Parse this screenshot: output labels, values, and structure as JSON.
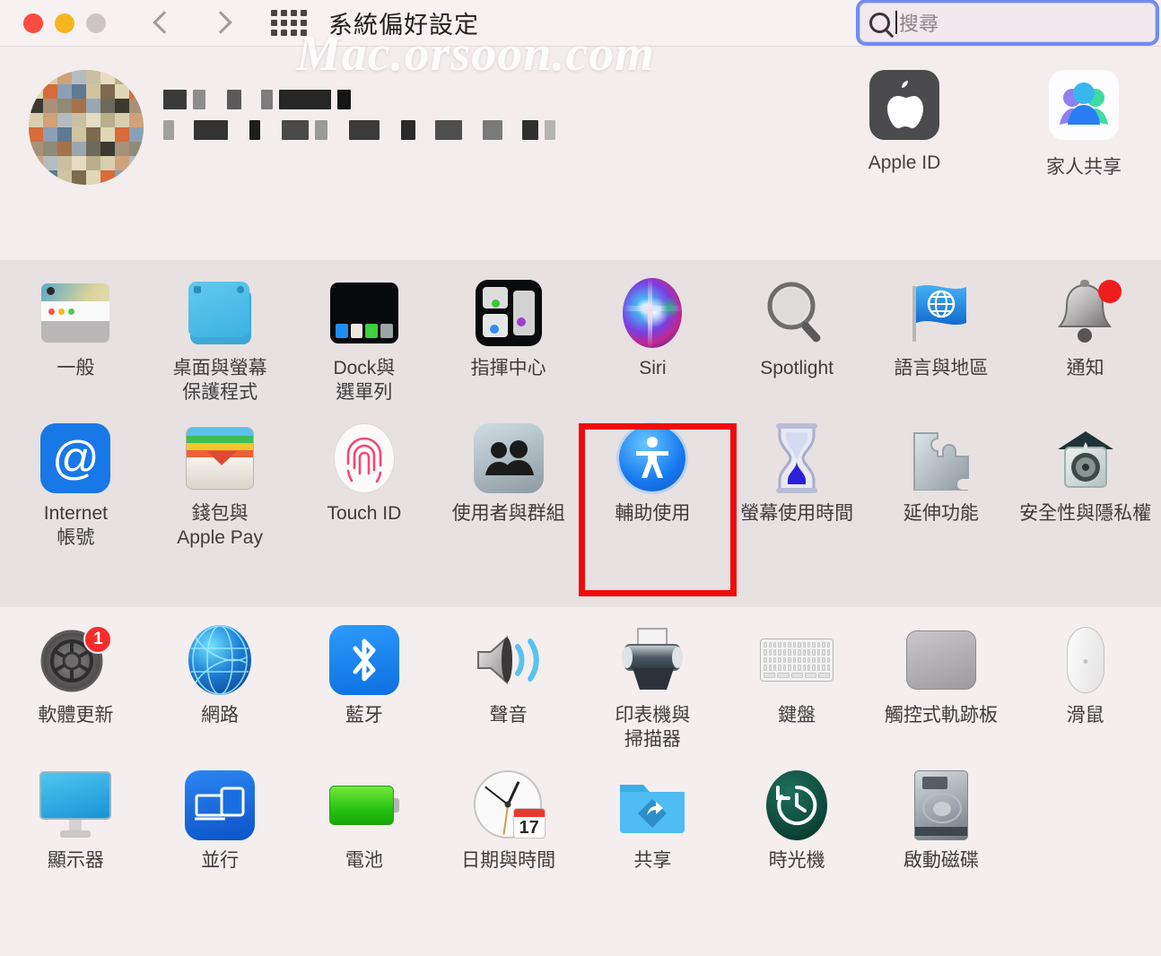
{
  "window": {
    "title": "系統偏好設定",
    "traffic_lights": [
      "close",
      "minimize",
      "zoom"
    ],
    "back_label": "返回",
    "forward_label": "前進",
    "show_all_label": "顯示全部"
  },
  "search": {
    "placeholder": "搜尋",
    "value": "",
    "icon": "search-icon",
    "focused": true
  },
  "watermark": {
    "text": "Mac.orsoon.com"
  },
  "account": {
    "avatar": "user-avatar-pixelated",
    "name_redacted": true,
    "name_placeholder": "",
    "detail_placeholder": ""
  },
  "top_items": [
    {
      "label": "Apple ID",
      "icon": "apple-logo-icon"
    },
    {
      "label": "家人共享",
      "icon": "family-sharing-icon"
    }
  ],
  "rows": [
    {
      "band": "mid",
      "items": [
        {
          "label": "一般",
          "icon": "general-icon"
        },
        {
          "label": "桌面與螢幕\n保護程式",
          "icon": "desktop-screensaver-icon"
        },
        {
          "label": "Dock與\n選單列",
          "icon": "dock-menubar-icon"
        },
        {
          "label": "指揮中心",
          "icon": "control-center-icon"
        },
        {
          "label": "Siri",
          "icon": "siri-icon"
        },
        {
          "label": "Spotlight",
          "icon": "spotlight-icon"
        },
        {
          "label": "語言與地區",
          "icon": "language-region-icon"
        },
        {
          "label": "通知",
          "icon": "notifications-icon",
          "badge": "dot"
        }
      ]
    },
    {
      "band": "mid",
      "items": [
        {
          "label": "Internet\n帳號",
          "icon": "internet-accounts-icon"
        },
        {
          "label": "錢包與\nApple Pay",
          "icon": "wallet-applepay-icon"
        },
        {
          "label": "Touch ID",
          "icon": "touchid-icon"
        },
        {
          "label": "使用者與群組",
          "icon": "users-groups-icon"
        },
        {
          "label": "輔助使用",
          "icon": "accessibility-icon",
          "highlighted": true
        },
        {
          "label": "螢幕使用時間",
          "icon": "screentime-icon"
        },
        {
          "label": "延伸功能",
          "icon": "extensions-icon"
        },
        {
          "label": "安全性與隱私權",
          "icon": "security-privacy-icon"
        }
      ]
    },
    {
      "band": "bottom",
      "items": [
        {
          "label": "軟體更新",
          "icon": "software-update-icon",
          "badge": "1"
        },
        {
          "label": "網路",
          "icon": "network-icon"
        },
        {
          "label": "藍牙",
          "icon": "bluetooth-icon"
        },
        {
          "label": "聲音",
          "icon": "sound-icon"
        },
        {
          "label": "印表機與\n掃描器",
          "icon": "printers-scanners-icon"
        },
        {
          "label": "鍵盤",
          "icon": "keyboard-icon"
        },
        {
          "label": "觸控式軌跡板",
          "icon": "trackpad-icon"
        },
        {
          "label": "滑鼠",
          "icon": "mouse-icon"
        }
      ]
    },
    {
      "band": "bottom",
      "items": [
        {
          "label": "顯示器",
          "icon": "displays-icon"
        },
        {
          "label": "並行",
          "icon": "sidecar-icon"
        },
        {
          "label": "電池",
          "icon": "battery-icon"
        },
        {
          "label": "日期與時間",
          "icon": "date-time-icon",
          "day": "17"
        },
        {
          "label": "共享",
          "icon": "sharing-icon"
        },
        {
          "label": "時光機",
          "icon": "time-machine-icon"
        },
        {
          "label": "啟動磁碟",
          "icon": "startup-disk-icon"
        }
      ]
    }
  ],
  "colors": {
    "window_bg": "#f4eeee",
    "band_mid_bg": "#e7e1e2",
    "titlebar_bg": "#f7f1f1",
    "highlight_red": "#ef0b0b",
    "focus_blue": "#5a78f5",
    "label_text": "#3f3b3c",
    "badge_red": "#f62c2c"
  }
}
